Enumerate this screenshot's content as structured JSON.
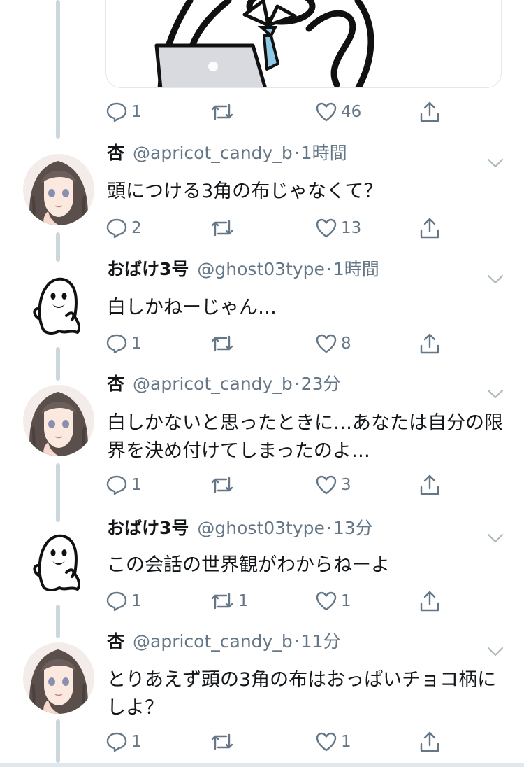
{
  "top_tweet_actions": {
    "reply_count": "1",
    "retweet_count": "",
    "like_count": "46"
  },
  "tweets": [
    {
      "name": "杏",
      "handle": "@apricot_candy_b",
      "time": "1時間",
      "text": "頭につける3角の布じゃなくて？",
      "reply_count": "2",
      "retweet_count": "",
      "like_count": "13",
      "avatar": "anime-girl-avatar"
    },
    {
      "name": "おばけ3号",
      "handle": "@ghost03type",
      "time": "1時間",
      "text": "白しかねーじゃん…",
      "reply_count": "1",
      "retweet_count": "",
      "like_count": "8",
      "avatar": "ghost-avatar"
    },
    {
      "name": "杏",
      "handle": "@apricot_candy_b",
      "time": "23分",
      "text": "白しかないと思ったときに…あなたは自分の限界を決め付けてしまったのよ…",
      "reply_count": "1",
      "retweet_count": "",
      "like_count": "3",
      "avatar": "anime-girl-avatar"
    },
    {
      "name": "おばけ3号",
      "handle": "@ghost03type",
      "time": "13分",
      "text": "この会話の世界観がわからねーよ",
      "reply_count": "1",
      "retweet_count": "1",
      "like_count": "1",
      "avatar": "ghost-avatar"
    },
    {
      "name": "杏",
      "handle": "@apricot_candy_b",
      "time": "11分",
      "text": "とりあえず頭の3角の布はおっぱいチョコ柄にしよ？",
      "reply_count": "1",
      "retweet_count": "",
      "like_count": "1",
      "avatar": "anime-girl-avatar"
    }
  ],
  "colors": {
    "text": "#14171a",
    "secondary": "#657786",
    "thread_line": "#ccd6dd",
    "tie": "#8ecae6"
  },
  "icons": [
    "reply-icon",
    "retweet-icon",
    "like-icon",
    "share-icon",
    "chevron-down-icon"
  ]
}
